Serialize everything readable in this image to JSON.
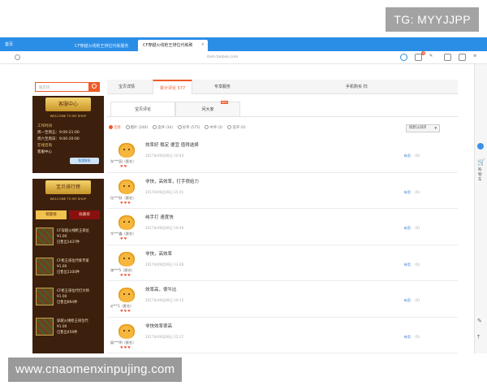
{
  "overlay": {
    "tg": "TG: MYYJJPP",
    "site_watermark": "www.cnaomenxinpujing.com"
  },
  "browser": {
    "brand_tab": "首页",
    "tabs": [
      "CF穿越火线枪王排位代练服务",
      "CF穿越火线枪王排位代练刷"
    ],
    "url": "item.taobao.com",
    "notification_count": "9"
  },
  "right_toolbar": {
    "cart_label": "购物车"
  },
  "sidebar": {
    "search_placeholder": "搜店内",
    "service": {
      "title": "客服中心",
      "welcome": "WELCOME TO MY SHOP",
      "hours_heading": "工作时间",
      "weekday": "周一至周五：9:00-21:00",
      "weekend": "周六至周日：9:00-20:00",
      "online_heading": "在线咨询",
      "support_label": "客服中心",
      "contact_button": "和我联系"
    },
    "ranking": {
      "title": "宝贝排行榜",
      "welcome": "WELCOME TO MY SHOP",
      "tabs": [
        "销量榜",
        "收藏榜"
      ],
      "products": [
        {
          "name": "CF穿越火线枪王排位",
          "price": "¥1.00",
          "sold": "已售出1437件"
        },
        {
          "name": "CF枪王排位代练专家",
          "price": "¥1.00",
          "sold": "已售出1100件"
        },
        {
          "name": "CF枪王排位代打大师",
          "price": "¥1.00",
          "sold": "已售出894件"
        },
        {
          "name": "穿越火线枪王排位代",
          "price": "¥1.00",
          "sold": "已售出459件"
        }
      ]
    }
  },
  "main": {
    "tabs": [
      {
        "label": "宝贝详情"
      },
      {
        "label": "累计评论 577"
      },
      {
        "label": "专享服务"
      },
      {
        "label": "手机购买 扫"
      }
    ],
    "subtabs": {
      "reviews": "宝贝评论",
      "qa": "问大家",
      "hot_badge": "NEW"
    },
    "filters": [
      "全部",
      "图片 (240)",
      "追评 (34)",
      "好评 (575)",
      "中评 (2)",
      "差评 (0)"
    ],
    "sort_label": "按默认排序",
    "reviews": [
      {
        "text": "效率好 稳定 便宜 值得选择",
        "user": "东***园（匿名）",
        "date": "2017年09月09日 10:43",
        "link_label": "有用",
        "count": "(0)"
      },
      {
        "text": "非快，高效率，打手很给力",
        "user": "拉***跃（匿名）",
        "date": "2017年09月09日 15:41",
        "link_label": "有用",
        "count": "(0)"
      },
      {
        "text": "纯手打 速度快",
        "user": "华***鑫（匿名）",
        "date": "2017年09月09日 16:49",
        "link_label": "有用",
        "count": "(0)"
      },
      {
        "text": "非快，高效率",
        "user": "骑***5（匿名）",
        "date": "2017年09月09日 13:46",
        "link_label": "有用",
        "count": "(0)"
      },
      {
        "text": "效率高，很牛比",
        "user": "q***1（匿名）",
        "date": "2017年09月09日 19:15",
        "link_label": "有用",
        "count": "(0)"
      },
      {
        "text": "非快效率很高",
        "user": "展***明（匿名）",
        "date": "2017年09月09日 22:17",
        "link_label": "有用",
        "count": "(0)"
      }
    ]
  }
}
